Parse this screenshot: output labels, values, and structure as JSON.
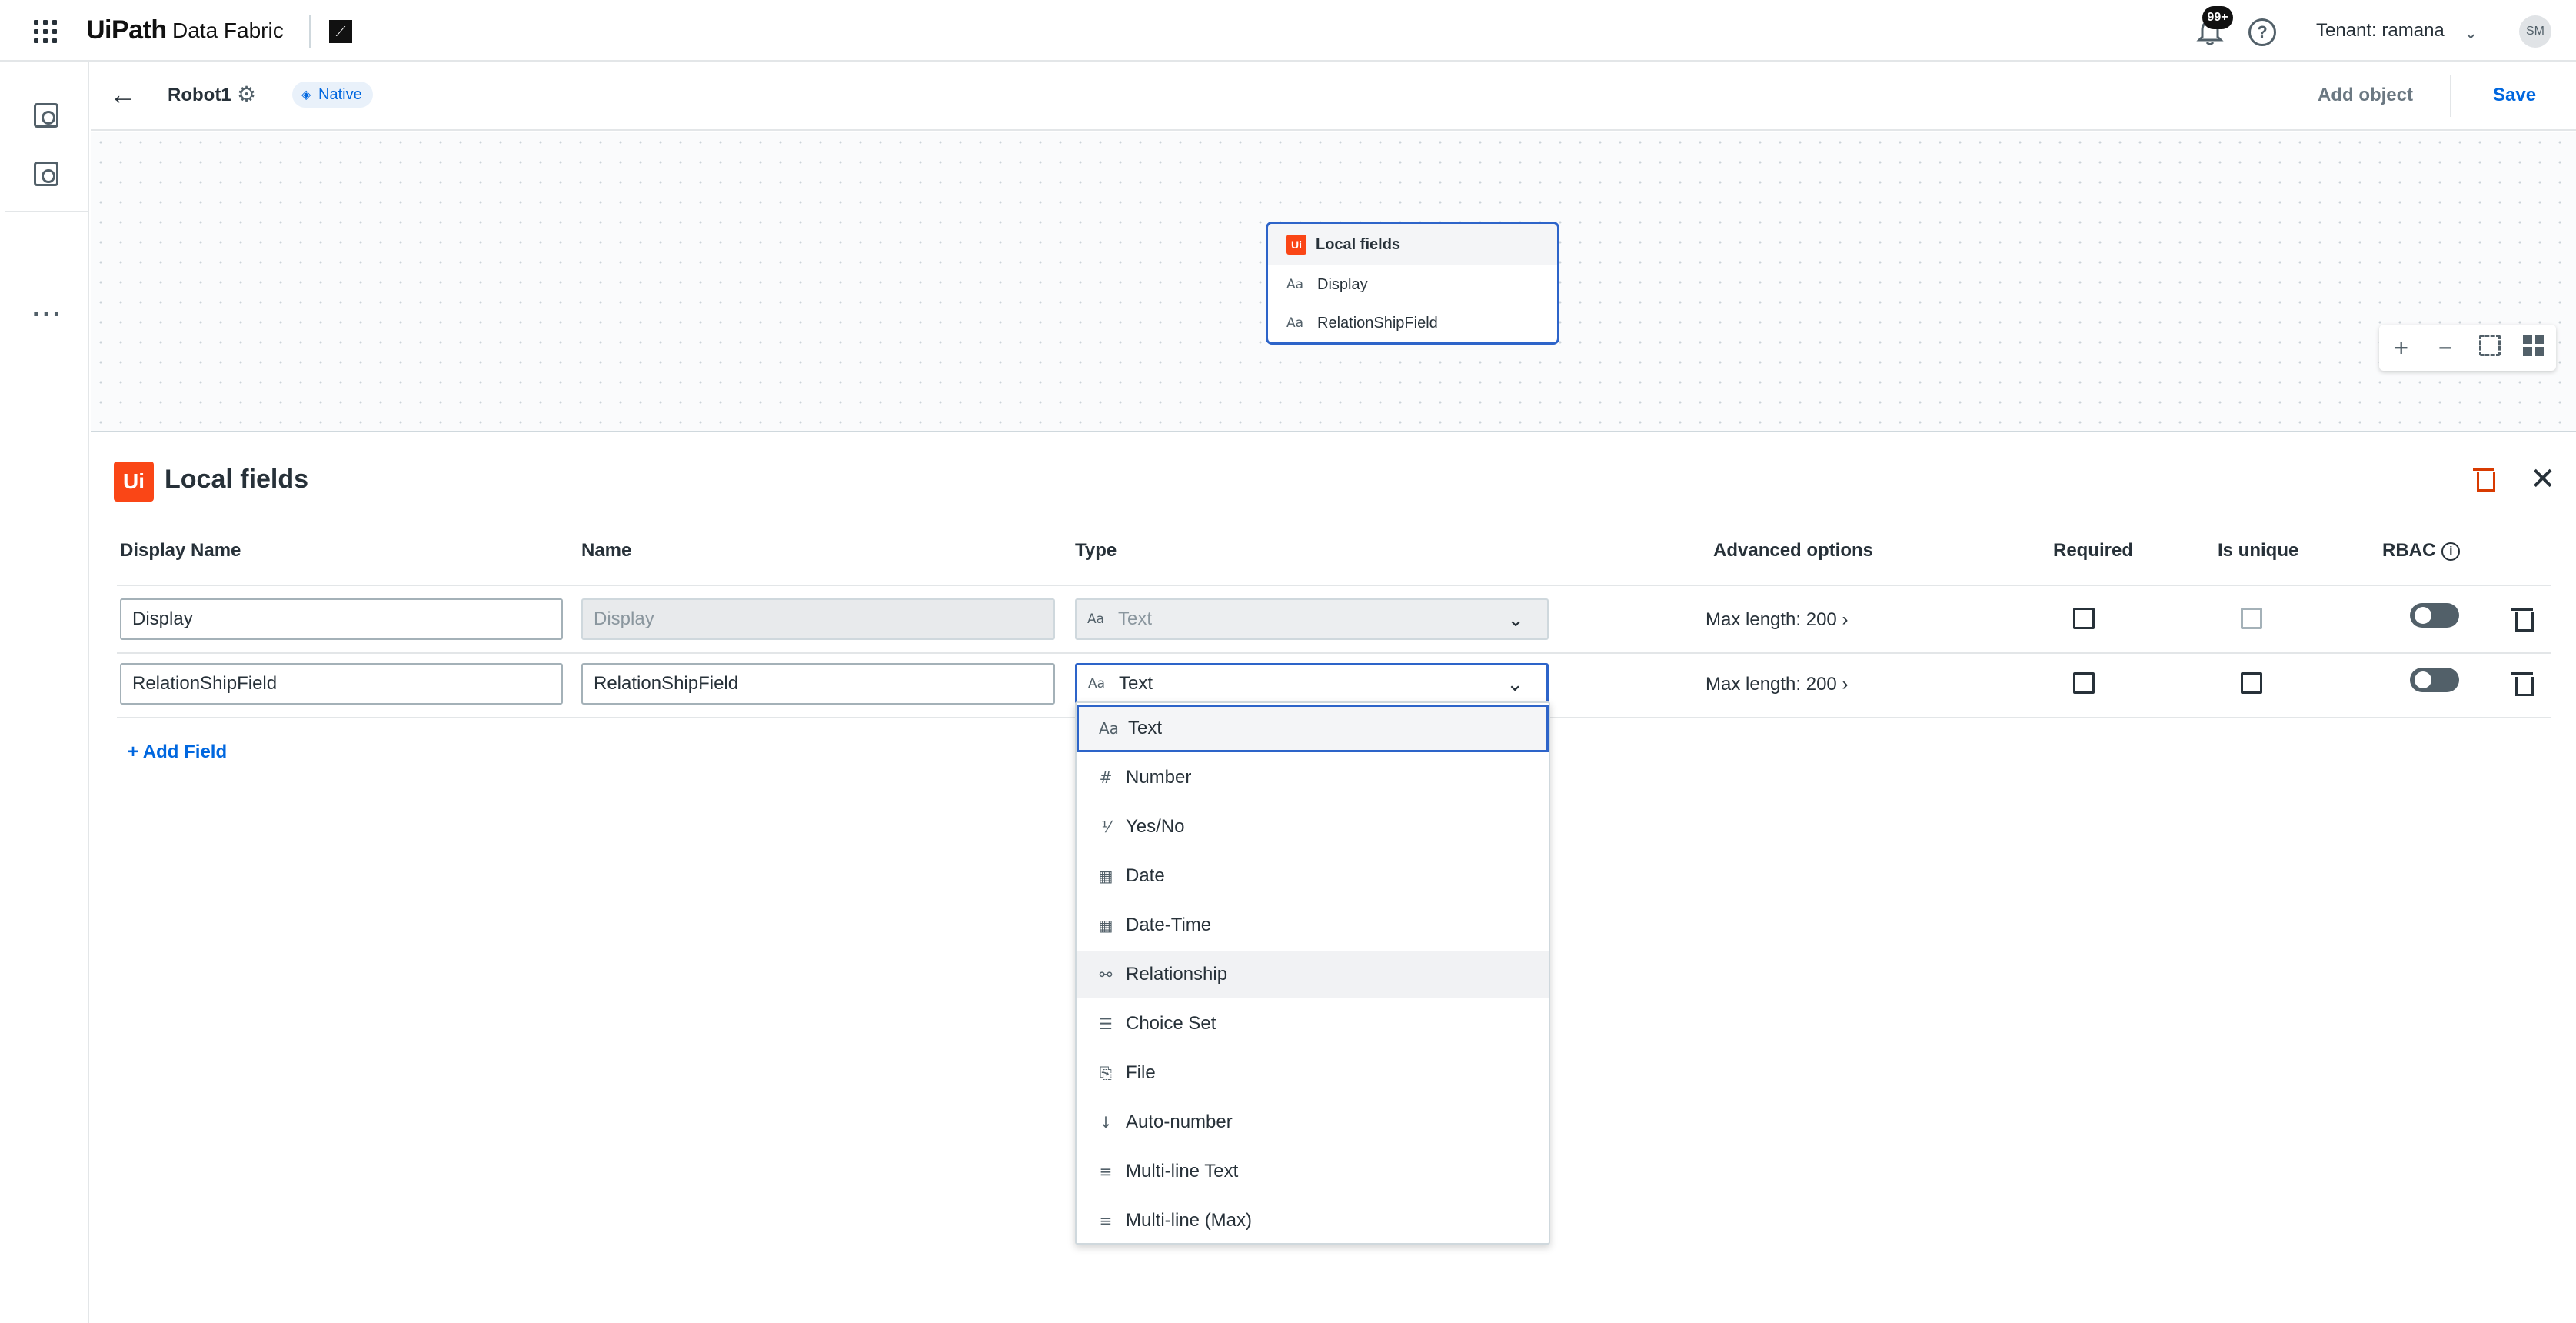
{
  "header": {
    "logo_text": "UiPath",
    "product": "Data Fabric",
    "notifications_badge": "99+",
    "tenant_label": "Tenant:",
    "tenant_name": "ramana",
    "avatar_initials": "SM"
  },
  "subheader": {
    "entity_name": "Robot1",
    "badge": "Native",
    "add_object": "Add object",
    "save": "Save"
  },
  "canvas": {
    "node": {
      "title": "Local fields",
      "logo": "Ui",
      "fields": [
        "Display",
        "RelationShipField"
      ],
      "field_icon": "Aa"
    },
    "zoom_controls": {
      "zoom_in": "+",
      "zoom_out": "−"
    }
  },
  "panel": {
    "logo": "Ui",
    "title": "Local fields",
    "columns": {
      "display_name": "Display Name",
      "name": "Name",
      "type": "Type",
      "advanced": "Advanced options",
      "required": "Required",
      "unique": "Is unique",
      "rbac": "RBAC"
    },
    "rows": [
      {
        "display_name": "Display",
        "name": "Display",
        "type": "Text",
        "type_icon": "Aa",
        "advanced": "Max length: 200 ›"
      },
      {
        "display_name": "RelationShipField",
        "name": "RelationShipField",
        "type": "Text",
        "type_icon": "Aa",
        "advanced": "Max length: 200 ›"
      }
    ],
    "add_field": "+ Add Field"
  },
  "dropdown": {
    "options": [
      {
        "label": "Text",
        "icon": "Aa"
      },
      {
        "label": "Number",
        "icon": "#"
      },
      {
        "label": "Yes/No",
        "icon": "⅟"
      },
      {
        "label": "Date",
        "icon": "▦"
      },
      {
        "label": "Date-Time",
        "icon": "▦"
      },
      {
        "label": "Relationship",
        "icon": "⚯"
      },
      {
        "label": "Choice Set",
        "icon": "☰"
      },
      {
        "label": "File",
        "icon": "⎘"
      },
      {
        "label": "Auto-number",
        "icon": "↓"
      },
      {
        "label": "Multi-line Text",
        "icon": "≡"
      },
      {
        "label": "Multi-line (Max)",
        "icon": "≡"
      }
    ]
  }
}
